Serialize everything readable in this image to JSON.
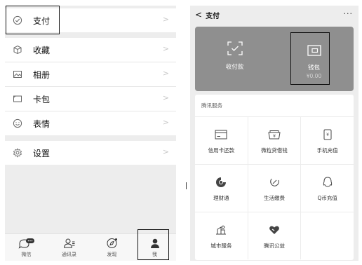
{
  "left": {
    "menu_groups": [
      [
        {
          "label": "支付",
          "icon": "pay-check-icon"
        }
      ],
      [
        {
          "label": "收藏",
          "icon": "cube-icon"
        },
        {
          "label": "相册",
          "icon": "image-icon"
        },
        {
          "label": "卡包",
          "icon": "card-icon"
        },
        {
          "label": "表情",
          "icon": "smiley-icon"
        }
      ],
      [
        {
          "label": "设置",
          "icon": "gear-icon"
        }
      ]
    ],
    "chevron": ">",
    "tabs": [
      {
        "label": "微信",
        "icon": "chat-icon"
      },
      {
        "label": "通讯录",
        "icon": "contacts-icon"
      },
      {
        "label": "发现",
        "icon": "compass-icon"
      },
      {
        "label": "我",
        "icon": "person-icon"
      }
    ]
  },
  "right": {
    "header": {
      "back": "<",
      "title": "支付",
      "more": "···"
    },
    "pay_panel": {
      "collect": {
        "label": "收付款",
        "icon": "scan-check-icon"
      },
      "wallet": {
        "label": "钱包",
        "sub": "¥0.00",
        "icon": "wallet-icon"
      }
    },
    "services": {
      "title": "腾讯服务",
      "rows": [
        [
          {
            "label": "信用卡还款",
            "icon": "credit-card-icon"
          },
          {
            "label": "微粒贷借钱",
            "icon": "loan-icon"
          },
          {
            "label": "手机充值",
            "icon": "phone-icon"
          }
        ],
        [
          {
            "label": "理财通",
            "icon": "wealth-icon"
          },
          {
            "label": "生活缴费",
            "icon": "leaf-icon"
          },
          {
            "label": "Q币充值",
            "icon": "qq-icon"
          }
        ],
        [
          {
            "label": "城市服务",
            "icon": "city-icon"
          },
          {
            "label": "腾讯公益",
            "icon": "heart-icon"
          }
        ]
      ]
    }
  }
}
